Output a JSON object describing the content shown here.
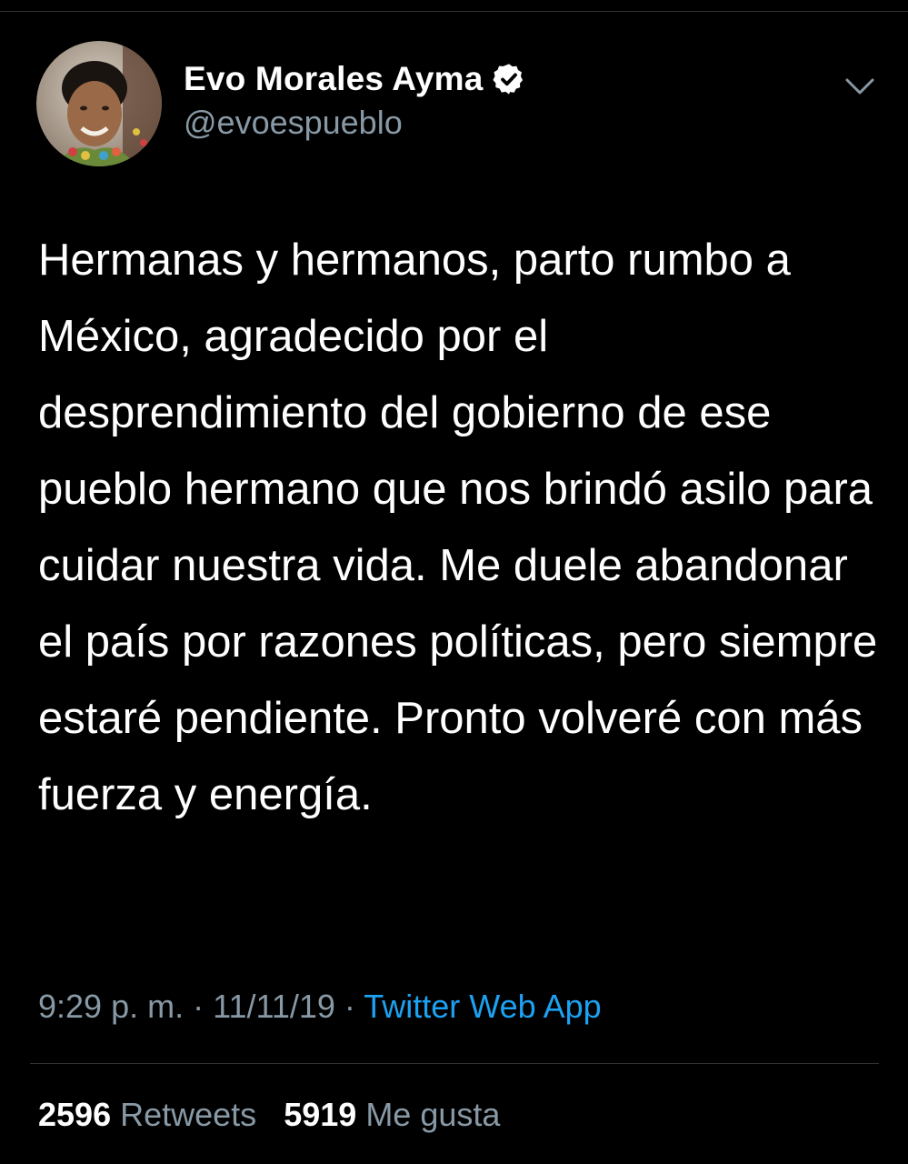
{
  "author": {
    "display_name": "Evo Morales Ayma",
    "handle": "@evoespueblo",
    "verified": true
  },
  "tweet": {
    "text": "Hermanas y hermanos, parto rumbo a México, agradecido por el desprendimiento del gobierno de ese pueblo hermano que nos brindó asilo para cuidar nuestra vida. Me duele abandonar el país por razones políticas, pero siempre estaré pendiente. Pronto volveré con más fuerza y energía."
  },
  "meta": {
    "time": "9:29 p. m.",
    "separator": " · ",
    "date": "11/11/19",
    "source": "Twitter Web App"
  },
  "stats": {
    "retweets_count": "2596",
    "retweets_label": "Retweets",
    "likes_count": "5919",
    "likes_label": "Me gusta"
  },
  "icons": {
    "verified": "verified-badge-icon",
    "caret": "chevron-down-icon"
  },
  "colors": {
    "background": "#000000",
    "text": "#ffffff",
    "muted": "#8899a6",
    "link": "#1da1f2",
    "divider": "#2f3336"
  }
}
